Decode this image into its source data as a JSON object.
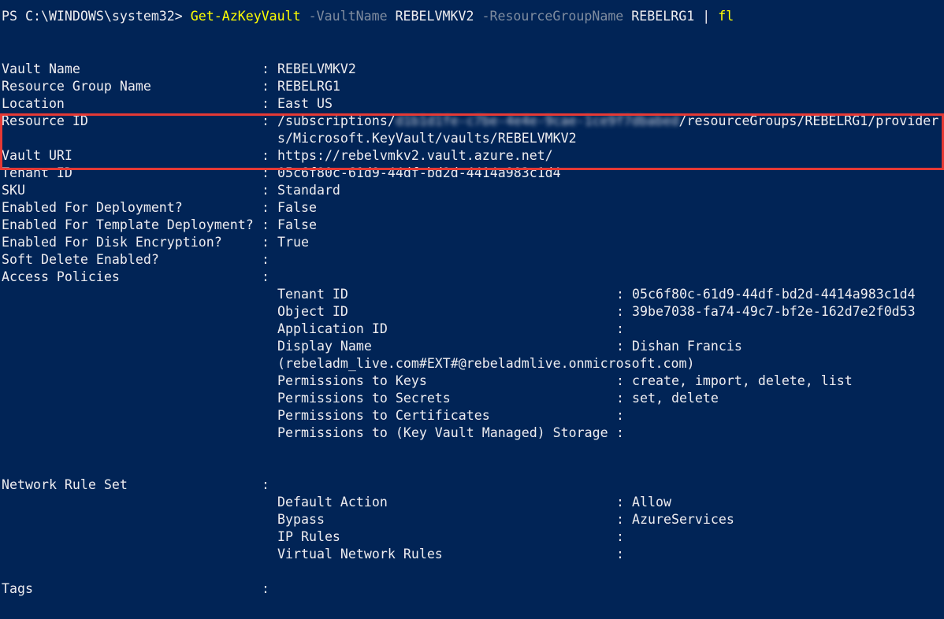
{
  "prompt": "PS C:\\WINDOWS\\system32> ",
  "command": {
    "cmdlet": "Get-AzKeyVault",
    "param1": "-VaultName",
    "arg1": "REBELVMKV2",
    "param2": "-ResourceGroupName",
    "arg2": "REBELRG1",
    "pipe": "|",
    "format": "fl"
  },
  "colon": ":",
  "props": {
    "vault_name": {
      "label": "Vault Name",
      "value": "REBELVMKV2"
    },
    "resource_group": {
      "label": "Resource Group Name",
      "value": "REBELRG1"
    },
    "location": {
      "label": "Location",
      "value": "East US"
    },
    "resource_id": {
      "label": "Resource ID",
      "prefix": "/subscriptions/",
      "redacted": "d1b1d1fe-c7be-4e4e-9cae-1ce9f7dbabed",
      "suffix": "/resourceGroups/REBELRG1/provider",
      "wrap": "s/Microsoft.KeyVault/vaults/REBELVMKV2"
    },
    "vault_uri": {
      "label": "Vault URI",
      "value": "https://rebelvmkv2.vault.azure.net/"
    },
    "tenant_id": {
      "label": "Tenant ID",
      "value": "05c6f80c-61d9-44df-bd2d-4414a983c1d4"
    },
    "sku": {
      "label": "SKU",
      "value": "Standard"
    },
    "deployment": {
      "label": "Enabled For Deployment?",
      "value": "False"
    },
    "template": {
      "label": "Enabled For Template Deployment?",
      "value": "False"
    },
    "disk": {
      "label": "Enabled For Disk Encryption?",
      "value": "True"
    },
    "soft_delete": {
      "label": "Soft Delete Enabled?",
      "value": ""
    },
    "access_policies": {
      "label": "Access Policies",
      "value": ""
    },
    "network_rule_set": {
      "label": "Network Rule Set",
      "value": ""
    },
    "tags": {
      "label": "Tags",
      "value": ""
    }
  },
  "access_policy": {
    "tenant_id": {
      "label": "Tenant ID",
      "value": "05c6f80c-61d9-44df-bd2d-4414a983c1d4"
    },
    "object_id": {
      "label": "Object ID",
      "value": "39be7038-fa74-49c7-bf2e-162d7e2f0d53"
    },
    "application_id": {
      "label": "Application ID",
      "value": ""
    },
    "display_name": {
      "label": "Display Name",
      "value": "Dishan Francis",
      "wrap": "(rebeladm_live.com#EXT#@rebeladmlive.onmicrosoft.com)"
    },
    "keys": {
      "label": "Permissions to Keys",
      "value": "create, import, delete, list"
    },
    "secrets": {
      "label": "Permissions to Secrets",
      "value": "set, delete"
    },
    "certificates": {
      "label": "Permissions to Certificates",
      "value": ""
    },
    "storage": {
      "label": "Permissions to (Key Vault Managed) Storage",
      "value": ""
    }
  },
  "network_rules": {
    "default_action": {
      "label": "Default Action",
      "value": "Allow"
    },
    "bypass": {
      "label": "Bypass",
      "value": "AzureServices"
    },
    "ip_rules": {
      "label": "IP Rules",
      "value": ""
    },
    "vnet_rules": {
      "label": "Virtual Network Rules",
      "value": ""
    }
  },
  "colors": {
    "background": "#012456",
    "foreground": "#eeedf0",
    "cmdlet": "#ffff00",
    "parameter": "#7f8c9f",
    "highlight_border": "#e53935"
  }
}
